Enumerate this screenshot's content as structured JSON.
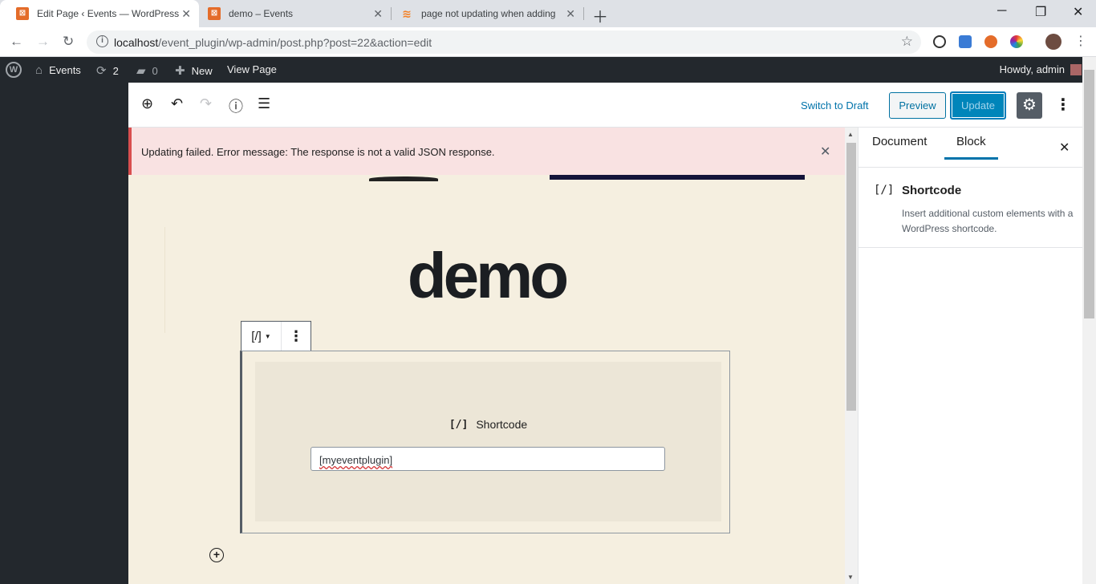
{
  "browser": {
    "tabs": [
      {
        "title": "Edit Page ‹ Events — WordPress",
        "active": true
      },
      {
        "title": "demo – Events",
        "active": false
      },
      {
        "title": "page not updating when adding",
        "active": false
      }
    ],
    "url_host": "localhost",
    "url_path": "/event_plugin/wp-admin/post.php?post=22&action=edit"
  },
  "adminbar": {
    "site_name": "Events",
    "updates_count": "2",
    "comments_count": "0",
    "new_label": "New",
    "view_page_label": "View Page",
    "howdy": "Howdy, admin"
  },
  "editor": {
    "switch_to_draft": "Switch to Draft",
    "preview": "Preview",
    "update": "Update"
  },
  "notice": {
    "message": "Updating failed. Error message: The response is not a valid JSON response."
  },
  "content": {
    "page_title": "demo",
    "block_icon": "[/]",
    "block_label": "Shortcode",
    "shortcode_value": "[myeventplugin]"
  },
  "sidebar": {
    "tab_document": "Document",
    "tab_block": "Block",
    "block_icon": "[/]",
    "block_title": "Shortcode",
    "block_description": "Insert additional custom elements with a WordPress shortcode."
  },
  "colors": {
    "accent": "#0073aa",
    "error": "#d94f4f",
    "adminbar": "#23282d",
    "canvas": "#f5efe0"
  }
}
